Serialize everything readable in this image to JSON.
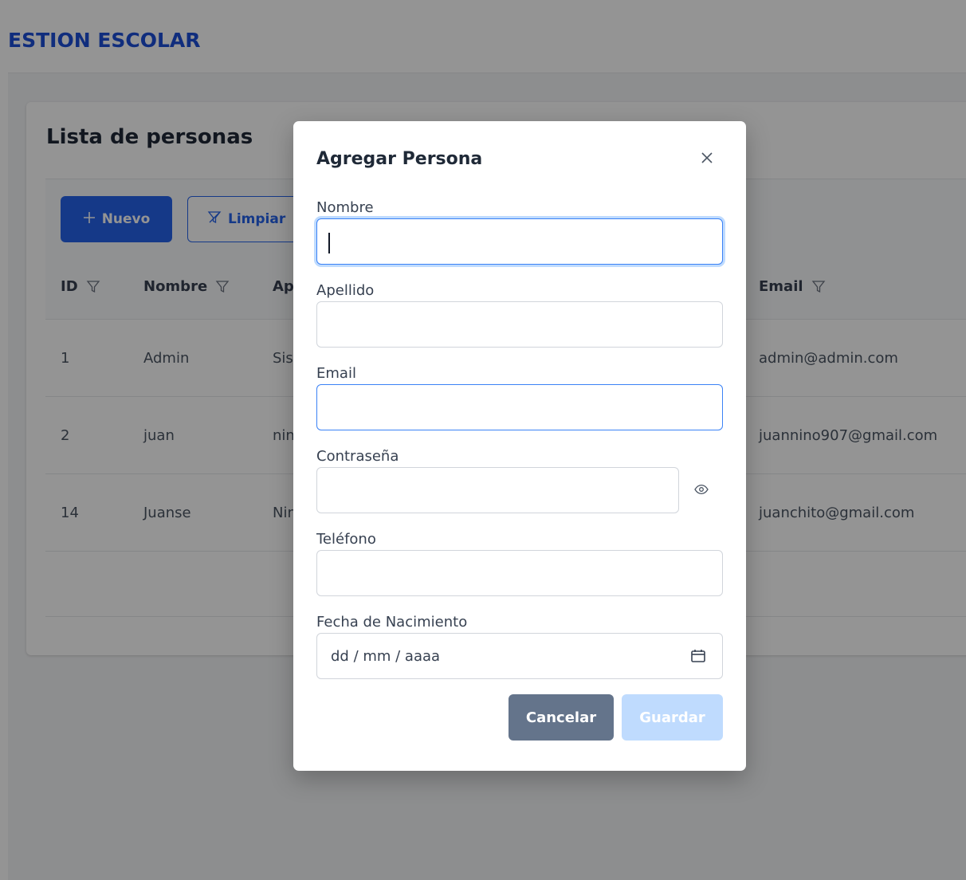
{
  "app": {
    "title": "ESTION ESCOLAR"
  },
  "card": {
    "title": "Lista de personas",
    "toolbar": {
      "new_label": "Nuevo",
      "clear_label": "Limpiar"
    },
    "columns": {
      "id": "ID",
      "nombre": "Nombre",
      "apellido": "Ap",
      "email": "Email"
    },
    "rows": [
      {
        "id": "1",
        "nombre": "Admin",
        "apellido": "Sis",
        "email": "admin@admin.com"
      },
      {
        "id": "2",
        "nombre": "juan",
        "apellido": "nin",
        "email": "juannino907@gmail.com"
      },
      {
        "id": "14",
        "nombre": "Juanse",
        "apellido": "Nin",
        "email": "juanchito@gmail.com"
      }
    ]
  },
  "modal": {
    "title": "Agregar Persona",
    "fields": {
      "nombre": {
        "label": "Nombre",
        "value": ""
      },
      "apellido": {
        "label": "Apellido",
        "value": ""
      },
      "email": {
        "label": "Email",
        "value": ""
      },
      "password": {
        "label": "Contraseña",
        "value": ""
      },
      "telefono": {
        "label": "Teléfono",
        "value": ""
      },
      "fecha": {
        "label": "Fecha de Nacimiento",
        "placeholder": "dd / mm / aaaa"
      }
    },
    "cancel_label": "Cancelar",
    "save_label": "Guardar"
  },
  "colors": {
    "primary": "#2563eb",
    "brand": "#1d4ed8",
    "cancel": "#64748b",
    "save_disabled": "#bfdbfe"
  },
  "icons": [
    "plus-icon",
    "filter-icon",
    "close-icon",
    "eye-icon",
    "calendar-icon"
  ]
}
